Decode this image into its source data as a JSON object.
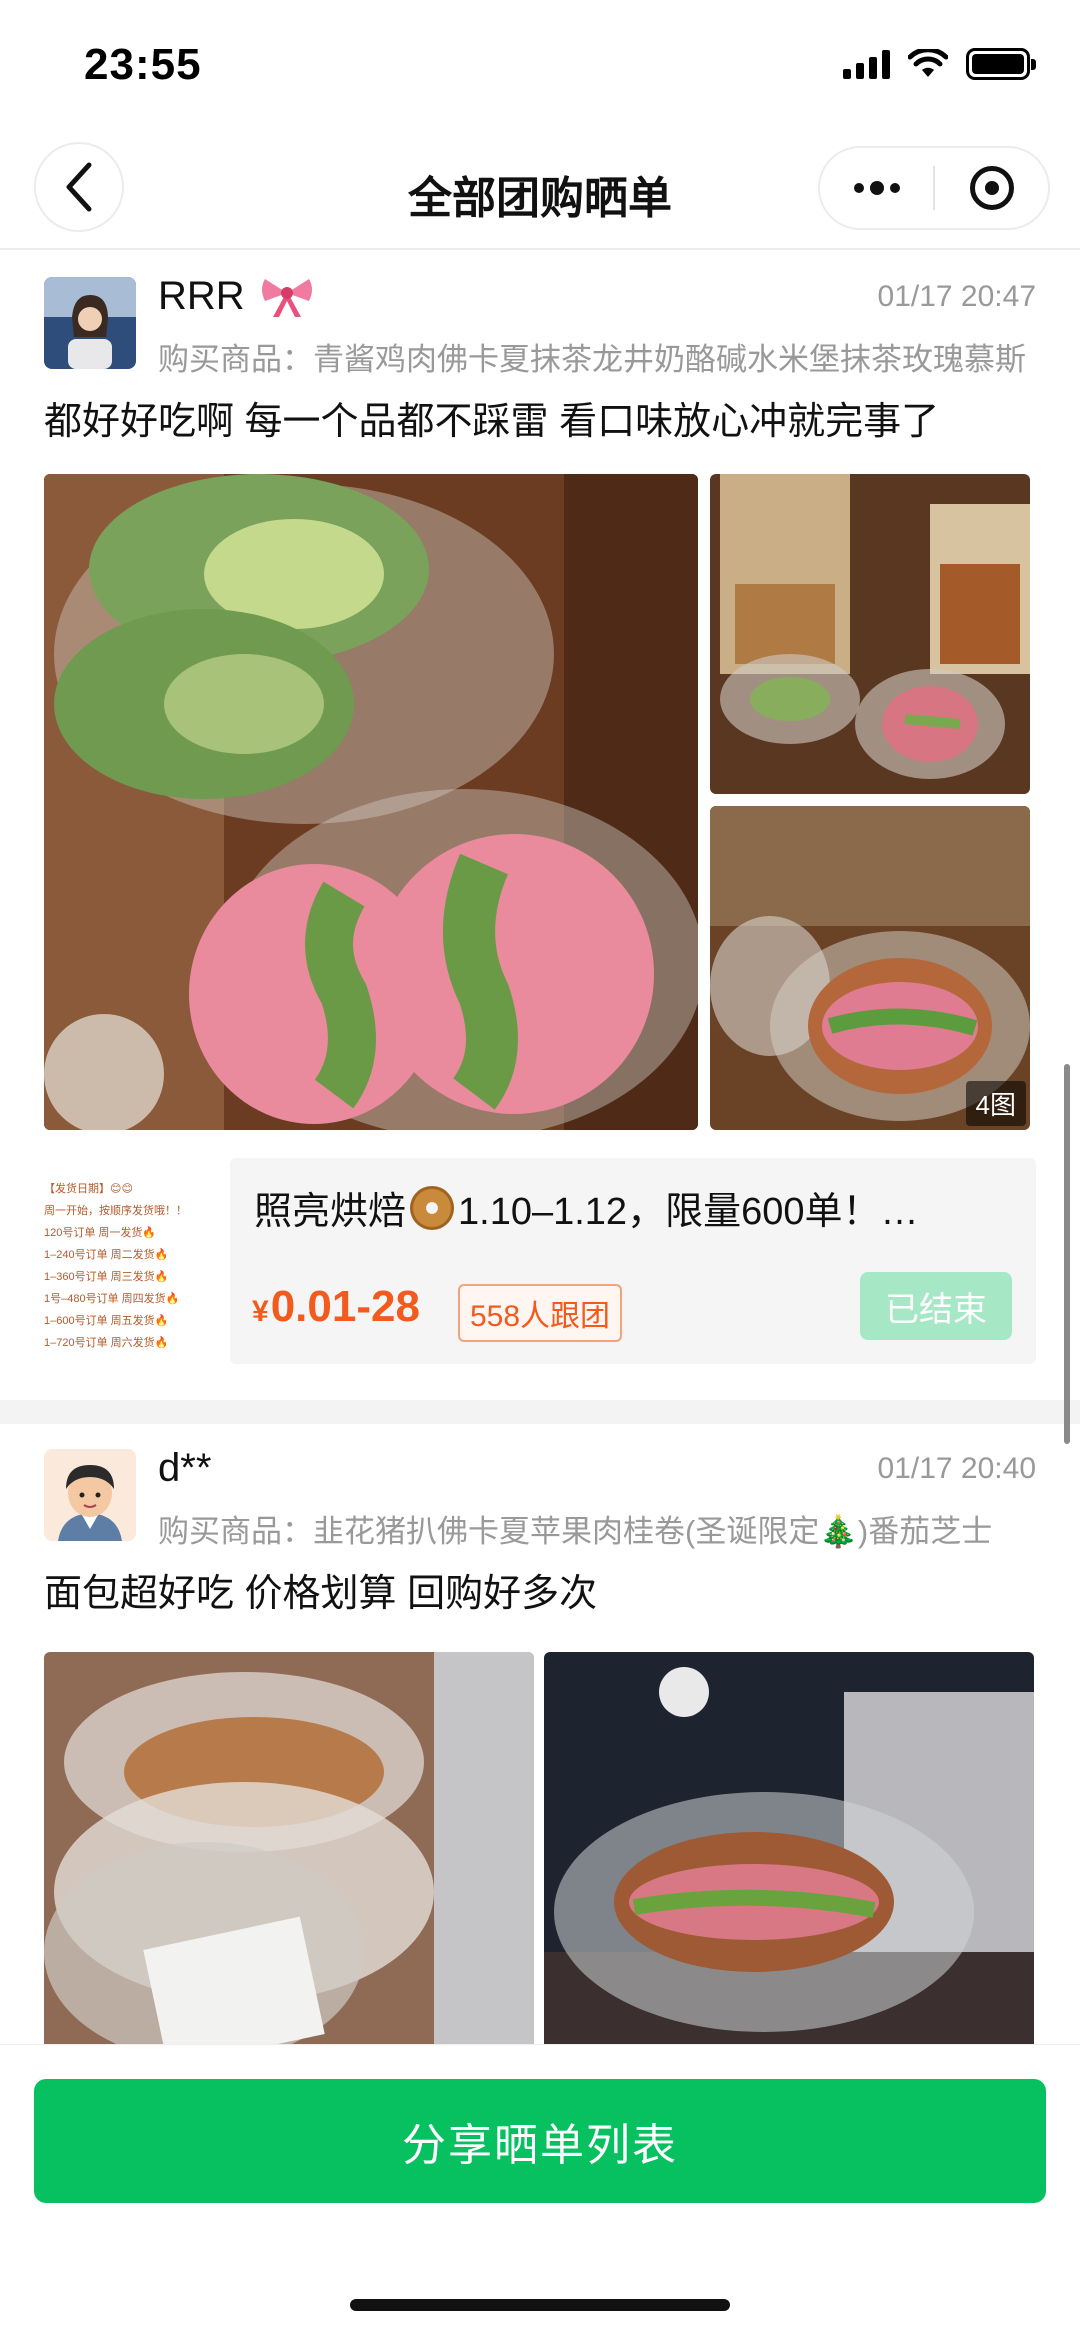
{
  "status_bar": {
    "time": "23:55"
  },
  "nav": {
    "title": "全部团购晒单"
  },
  "posts": [
    {
      "user": "RRR",
      "time": "01/17 20:47",
      "product": "购买商品：青酱鸡肉佛卡夏抹茶龙井奶酪碱水米堡抹茶玫瑰慕斯",
      "text": "都好好吃啊 每一个品都不踩雷 看口味放心冲就完事了",
      "image_count": "4图"
    },
    {
      "user": "d**",
      "time": "01/17 20:40",
      "product": "购买商品：韭花猪扒佛卡夏苹果肉桂卷(圣诞限定🎄)番茄芝士",
      "text": "面包超好吃 价格划算 回购好多次"
    }
  ],
  "group_card": {
    "title_pre": "照亮烘焙",
    "title_post": "1.10–1.12，限量600单！…",
    "price_symbol": "¥",
    "price": "0.01-28",
    "followers": "558人跟团",
    "status": "已结束",
    "thumb_lines": [
      "【发货日期】😊😊",
      "周一开始，按顺序发货哦！！",
      "120号订单 周一发货🔥",
      "1–240号订单 周二发货🔥",
      "1–360号订单 周三发货🔥",
      "1号–480号订单 周四发货🔥",
      "1–600号订单 周五发货🔥",
      "1–720号订单 周六发货🔥"
    ]
  },
  "footer": {
    "share_label": "分享晒单列表"
  },
  "colors": {
    "accent": "#07c160",
    "price": "#f25a1e",
    "ended": "#a6e7c5"
  }
}
